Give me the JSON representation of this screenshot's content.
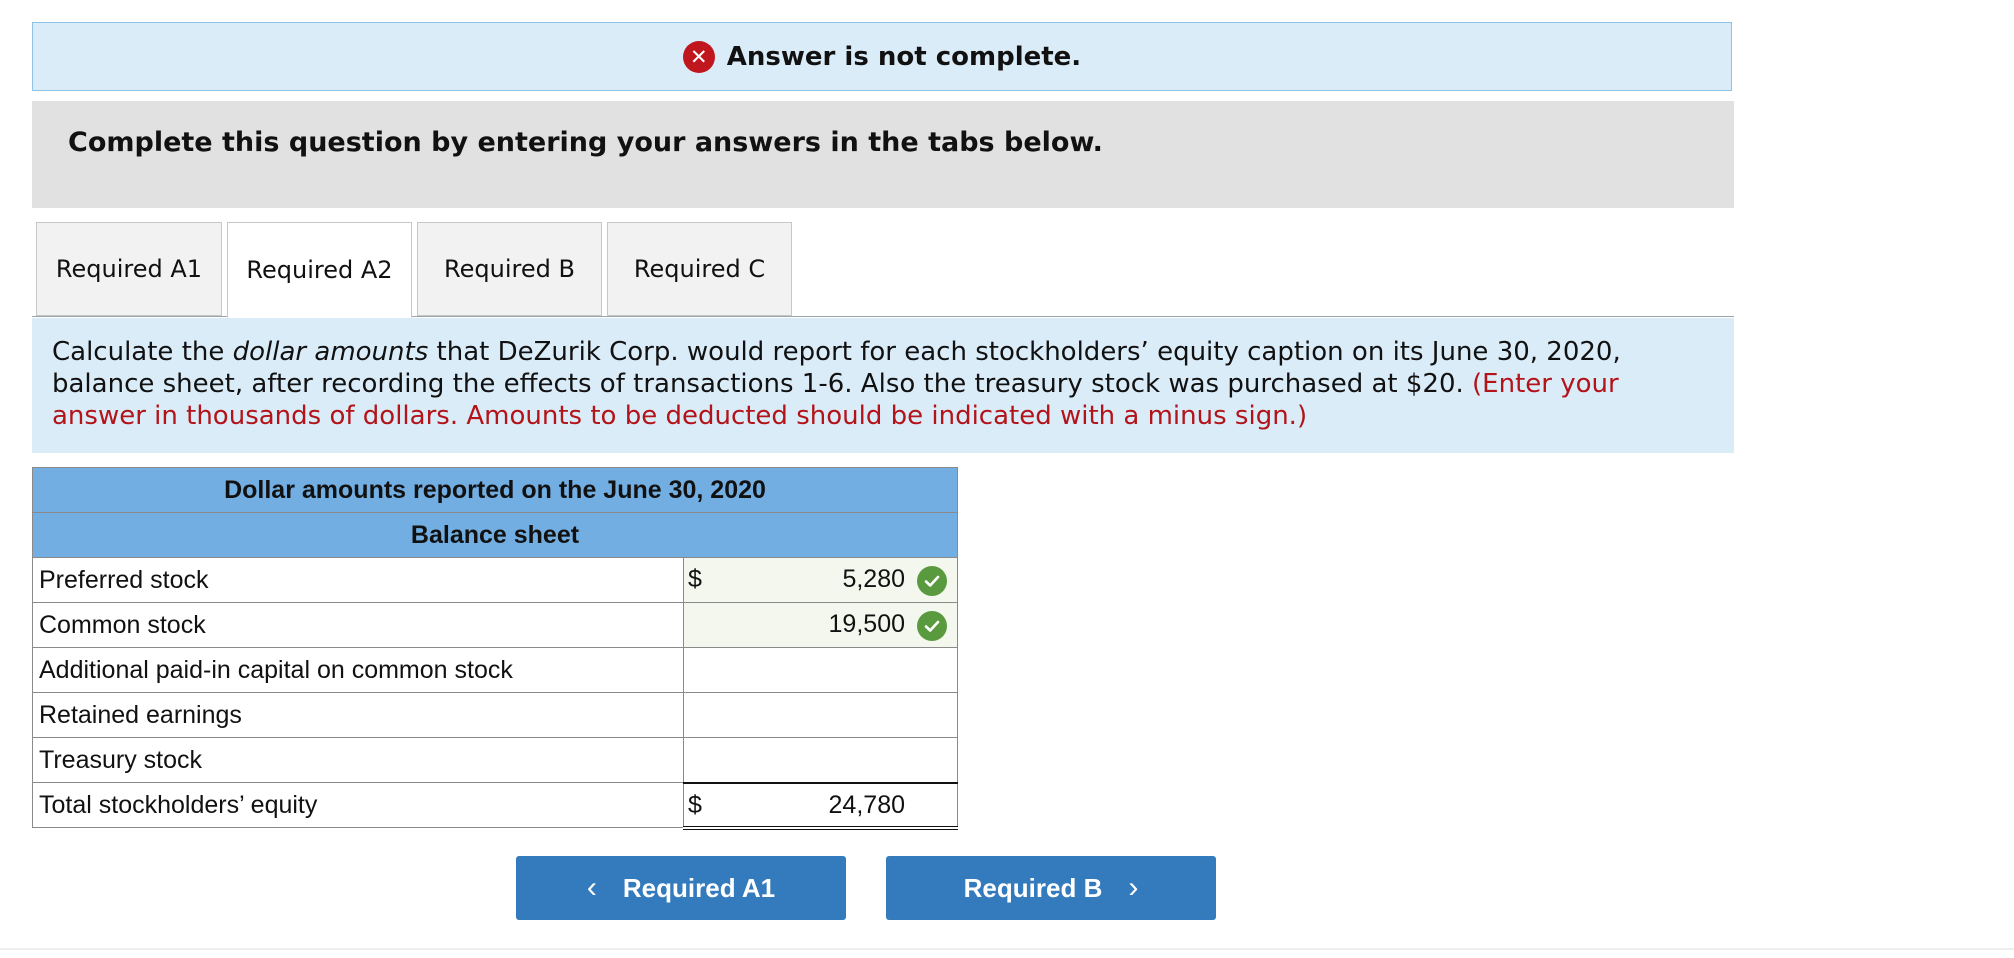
{
  "alert": {
    "icon": "close-icon",
    "text": "Answer is not complete."
  },
  "instruction": "Complete this question by entering your answers in the tabs below.",
  "tabs": [
    {
      "label": "Required A1",
      "active": false
    },
    {
      "label": "Required A2",
      "active": true
    },
    {
      "label": "Required B",
      "active": false
    },
    {
      "label": "Required C",
      "active": false
    }
  ],
  "question": {
    "part1": "Calculate the ",
    "emphasis": "dollar amounts",
    "part2": " that DeZurik Corp. would report for each stockholders’ equity caption on its June 30, 2020, balance sheet, after recording the effects of transactions 1-6. Also the treasury stock was purchased at $20. ",
    "hint": "(Enter your answer in thousands of dollars. Amounts to be deducted should be indicated with a minus sign.)"
  },
  "table": {
    "header1": "Dollar amounts reported on the June 30, 2020",
    "header2": "Balance sheet",
    "rows": [
      {
        "label": "Preferred stock",
        "currency": "$",
        "value": "5,280",
        "correct": true
      },
      {
        "label": "Common stock",
        "currency": "",
        "value": "19,500",
        "correct": true
      },
      {
        "label": "Additional paid-in capital on common stock",
        "currency": "",
        "value": "",
        "correct": false
      },
      {
        "label": "Retained earnings",
        "currency": "",
        "value": "",
        "correct": false
      },
      {
        "label": "Treasury stock",
        "currency": "",
        "value": "",
        "correct": false
      },
      {
        "label": "Total stockholders’ equity",
        "currency": "$",
        "value": "24,780",
        "correct": false
      }
    ]
  },
  "nav": {
    "prev_label": "Required A1",
    "next_label": "Required B"
  },
  "colors": {
    "accent": "#347bbd",
    "header": "#72aee2",
    "error": "#c0161d",
    "success": "#5a9a3e"
  }
}
